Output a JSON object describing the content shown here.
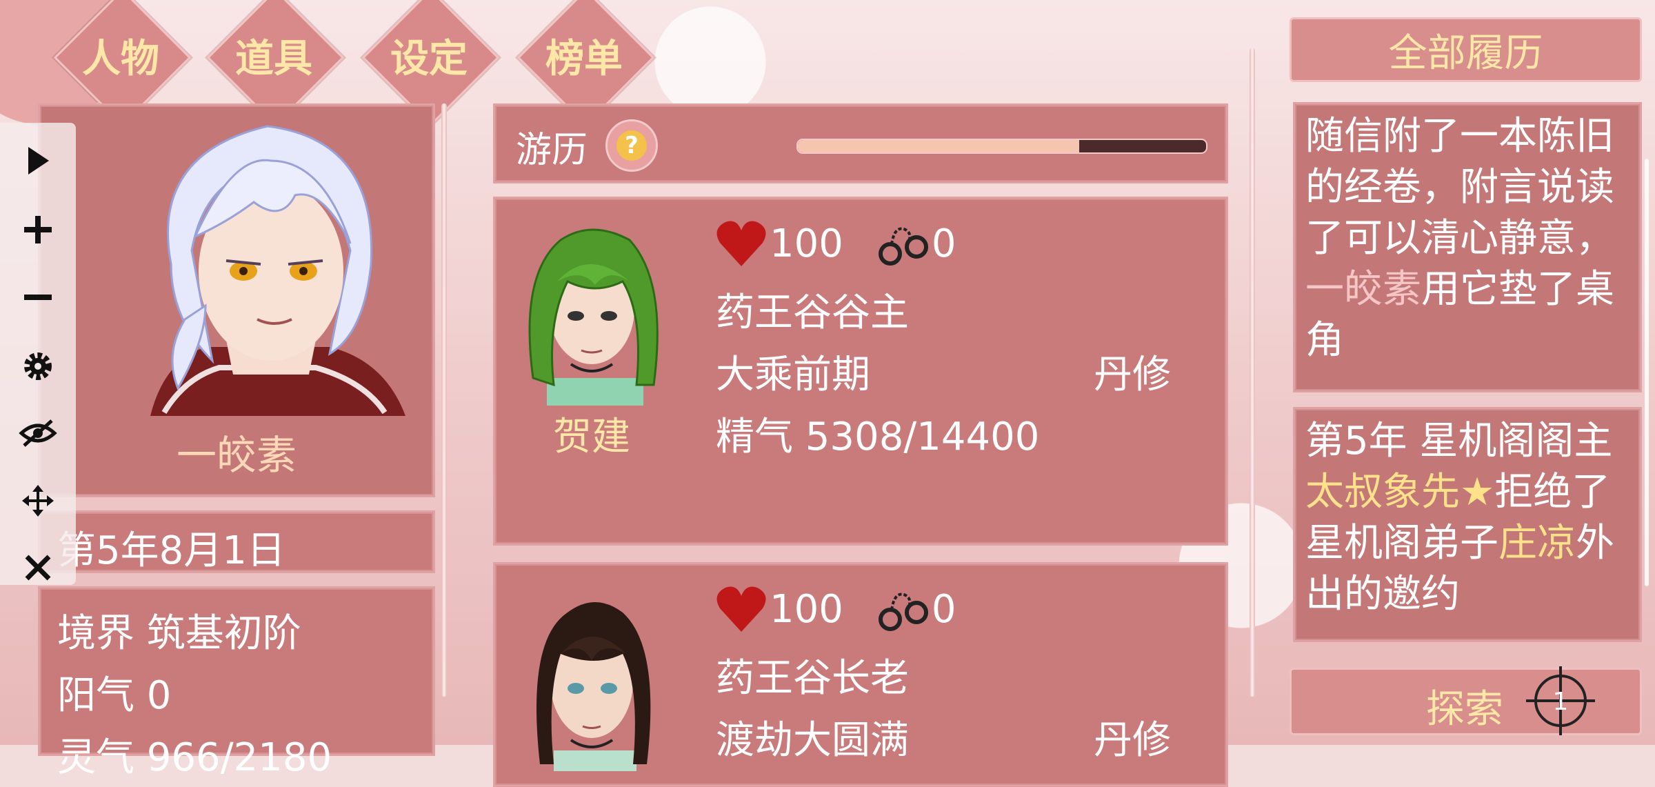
{
  "tabs": [
    "人物",
    "道具",
    "设定",
    "榜单"
  ],
  "player": {
    "name": "一皎素",
    "date": "第5年8月1日",
    "stats": [
      "境界 筑基初阶",
      "阳气 0",
      "灵气 966/2180"
    ]
  },
  "toolbar": [
    "play-icon",
    "plus-icon",
    "minus-icon",
    "gear-icon",
    "eye-off-icon",
    "move-icon",
    "close-icon"
  ],
  "youli": {
    "label": "游历",
    "help": "?",
    "progress": 0.69
  },
  "cards": [
    {
      "name": "贺建",
      "hp": "100",
      "bonds": "0",
      "title": "药王谷谷主",
      "realm": "大乘前期",
      "type": "丹修",
      "essence": "精气 5308/14400"
    },
    {
      "hp": "100",
      "bonds": "0",
      "title": "药王谷长老",
      "realm": "渡劫大圆满",
      "type": "丹修"
    }
  ],
  "history": {
    "button": "全部履历",
    "log1": {
      "pre": "随信附了一本陈旧的经卷，附言说读了可以清心静意，",
      "name": "一皎素",
      "post": "用它垫了桌角"
    },
    "log2": {
      "pre": "第5年 星机阁阁主",
      "name1": "太叔象先★",
      "mid": "拒绝了星机阁弟子",
      "name2": "庄凉",
      "post": "外出的邀约"
    }
  },
  "explore": {
    "label": "探索",
    "badge": "1"
  },
  "colors": {
    "accent": "#ffe7a8",
    "panel": "#c97a7a",
    "heart": "#c01818"
  }
}
